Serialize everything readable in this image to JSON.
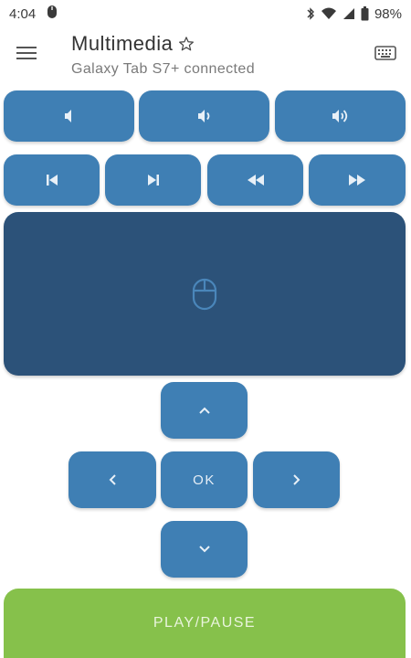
{
  "status_bar": {
    "time": "4:04",
    "battery": "98%",
    "icons": [
      "mouse-notification-icon",
      "bluetooth-icon",
      "wifi-icon",
      "signal-icon",
      "battery-icon"
    ]
  },
  "app_bar": {
    "title": "Multimedia",
    "subtitle": "Galaxy Tab S7+ connected",
    "icons": [
      "hamburger-menu-icon",
      "star-icon",
      "keyboard-icon"
    ]
  },
  "volume_row": {
    "icons": [
      "volume-mute-icon",
      "volume-down-icon",
      "volume-up-icon"
    ]
  },
  "media_row": {
    "icons": [
      "skip-previous-icon",
      "skip-next-icon",
      "rewind-icon",
      "fast-forward-icon"
    ]
  },
  "touchpad": {
    "icon": "mouse-icon"
  },
  "dpad": {
    "ok_label": "OK",
    "icons": [
      "chevron-up-icon",
      "chevron-left-icon",
      "chevron-right-icon",
      "chevron-down-icon"
    ]
  },
  "play_pause": {
    "label": "PLAY/PAUSE"
  },
  "colors": {
    "button": "#3f7fb4",
    "touchpad": "#2c5279",
    "play_pause": "#86c14b",
    "icon": "#e8f0f7"
  }
}
